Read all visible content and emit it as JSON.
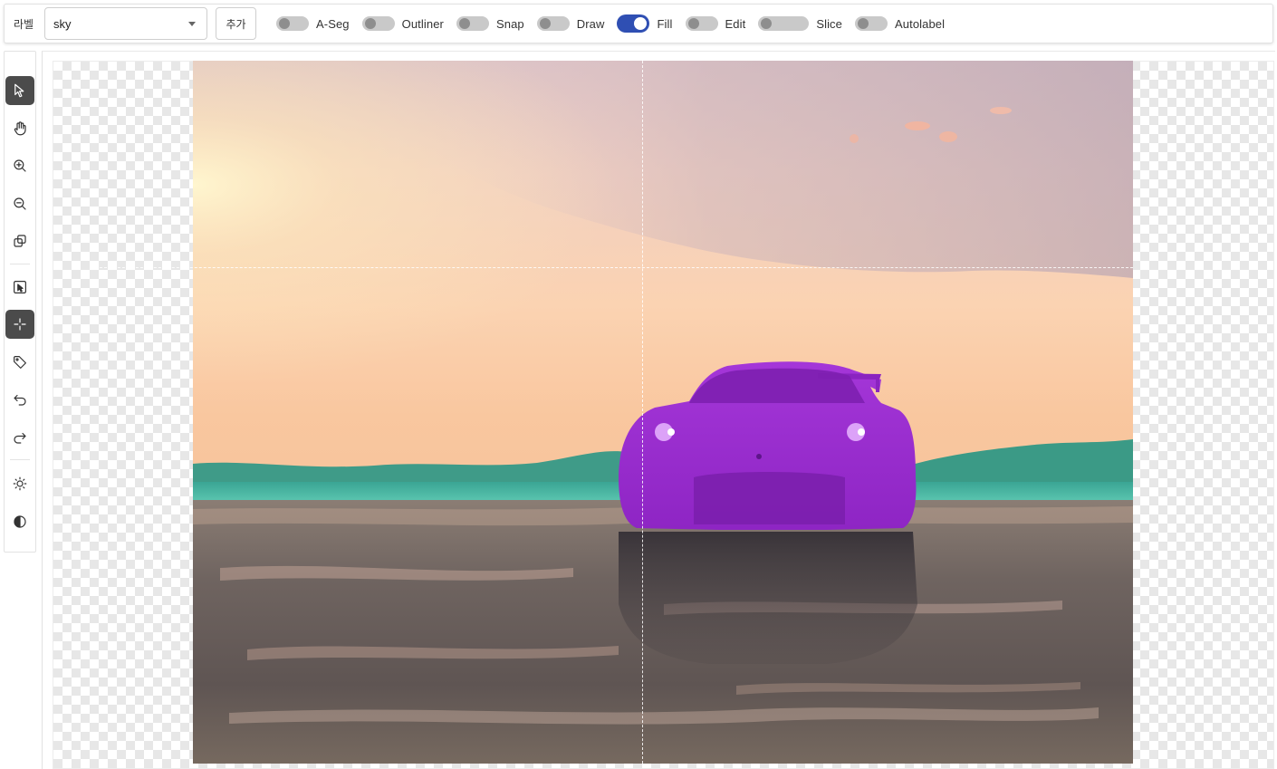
{
  "toolbar": {
    "label_caption": "라벨",
    "label_select": {
      "value": "sky"
    },
    "add_button": "추가",
    "toggles": [
      {
        "label": "A-Seg",
        "on": false
      },
      {
        "label": "Outliner",
        "on": false
      },
      {
        "label": "Snap",
        "on": false
      },
      {
        "label": "Draw",
        "on": false
      },
      {
        "label": "Fill",
        "on": true
      },
      {
        "label": "Edit",
        "on": false
      },
      {
        "label": "Slice",
        "on": false
      },
      {
        "label": "Autolabel",
        "on": false
      }
    ],
    "accent_color": "#2f4fb3"
  },
  "tools": [
    {
      "icon": "pointer-icon",
      "active": true
    },
    {
      "icon": "hand-icon",
      "active": false
    },
    {
      "icon": "zoom-in-icon",
      "active": false
    },
    {
      "icon": "zoom-out-icon",
      "active": false
    },
    {
      "icon": "copy-icon",
      "active": false
    },
    {
      "icon": "select-box-icon",
      "active": false
    },
    {
      "icon": "crosshair-icon",
      "active": true
    },
    {
      "icon": "tag-icon",
      "active": false
    },
    {
      "icon": "undo-icon",
      "active": false
    },
    {
      "icon": "redo-icon",
      "active": false
    },
    {
      "icon": "brightness-icon",
      "active": false
    },
    {
      "icon": "contrast-icon",
      "active": false
    }
  ],
  "canvas": {
    "segmentation_color": "#9a2fd6"
  }
}
